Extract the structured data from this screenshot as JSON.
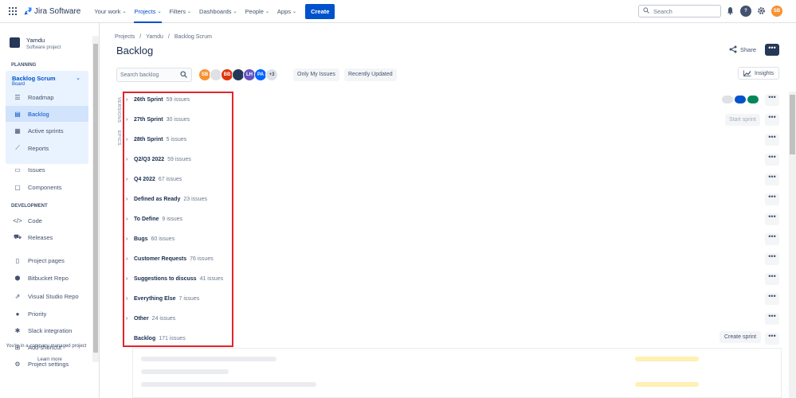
{
  "topnav": {
    "logo_text": "Jira Software",
    "items": [
      {
        "label": "Your work",
        "active": false
      },
      {
        "label": "Projects",
        "active": true
      },
      {
        "label": "Filters",
        "active": false
      },
      {
        "label": "Dashboards",
        "active": false
      },
      {
        "label": "People",
        "active": false
      },
      {
        "label": "Apps",
        "active": false
      }
    ],
    "create_label": "Create",
    "search_placeholder": "Search",
    "user_initials": "SB"
  },
  "sidebar": {
    "project_name": "Yamdu",
    "project_type": "Software project",
    "planning_label": "PLANNING",
    "board_name": "Backlog Scrum",
    "board_type": "Board",
    "planning_items": [
      {
        "label": "Roadmap",
        "icon": "roadmap-icon"
      },
      {
        "label": "Backlog",
        "icon": "backlog-icon",
        "selected": true
      },
      {
        "label": "Active sprints",
        "icon": "board-icon"
      },
      {
        "label": "Reports",
        "icon": "reports-icon"
      }
    ],
    "other_items": [
      {
        "label": "Issues",
        "icon": "issues-icon"
      },
      {
        "label": "Components",
        "icon": "components-icon"
      }
    ],
    "development_label": "DEVELOPMENT",
    "dev_items": [
      {
        "label": "Code",
        "icon": "code-icon"
      },
      {
        "label": "Releases",
        "icon": "releases-icon"
      }
    ],
    "more_items": [
      {
        "label": "Project pages",
        "icon": "pages-icon"
      },
      {
        "label": "Bitbucket Repo",
        "icon": "bitbucket-icon"
      },
      {
        "label": "Visual Studio Repo",
        "icon": "external-link-icon"
      },
      {
        "label": "Priority",
        "icon": "priority-icon"
      },
      {
        "label": "Slack integration",
        "icon": "slack-icon"
      },
      {
        "label": "Add shortcut",
        "icon": "add-shortcut-icon"
      },
      {
        "label": "Project settings",
        "icon": "settings-icon"
      }
    ],
    "footer_text": "You're in a company-managed project",
    "learn_more": "Learn more"
  },
  "main": {
    "breadcrumb": [
      "Projects",
      "Yamdu",
      "Backlog Scrum"
    ],
    "title": "Backlog",
    "share_label": "Share",
    "search_placeholder": "Search backlog",
    "avatars": [
      {
        "initials": "SB",
        "color": "#f79232"
      },
      {
        "initials": "",
        "color": "#dfe1e6"
      },
      {
        "initials": "BB",
        "color": "#de350b"
      },
      {
        "initials": "",
        "color": "#253858"
      },
      {
        "initials": "LH",
        "color": "#6554c0"
      },
      {
        "initials": "PA",
        "color": "#0065ff"
      },
      {
        "initials": "+3",
        "color": "#dfe1e6"
      }
    ],
    "only_my_issues": "Only My Issues",
    "recently_updated": "Recently Updated",
    "insights_label": "Insights",
    "versions_tab": "VERSIONS",
    "epics_tab": "EPICS",
    "start_sprint": "Start sprint",
    "create_sprint": "Create sprint",
    "sprints": [
      {
        "name": "26th Sprint",
        "count": "59 issues"
      },
      {
        "name": "27th Sprint",
        "count": "30 issues"
      },
      {
        "name": "28th Sprint",
        "count": "5 issues"
      },
      {
        "name": "Q2/Q3 2022",
        "count": "59 issues"
      },
      {
        "name": "Q4 2022",
        "count": "67 issues"
      },
      {
        "name": "Defined as Ready",
        "count": "23 issues"
      },
      {
        "name": "To Define",
        "count": "9 issues"
      },
      {
        "name": "Bugs",
        "count": "60 issues"
      },
      {
        "name": "Customer Requests",
        "count": "76 issues"
      },
      {
        "name": "Suggestions to discuss",
        "count": "41 issues"
      },
      {
        "name": "Everything Else",
        "count": "7 issues"
      },
      {
        "name": "Other",
        "count": "24 issues"
      },
      {
        "name": "Backlog",
        "count": "171 issues"
      }
    ],
    "more_glyph": "•••",
    "status_colors": [
      "#dfe1e6",
      "#0052cc",
      "#00875a"
    ]
  },
  "icons": {
    "chevron": "›",
    "chevron_down": "⌄"
  }
}
